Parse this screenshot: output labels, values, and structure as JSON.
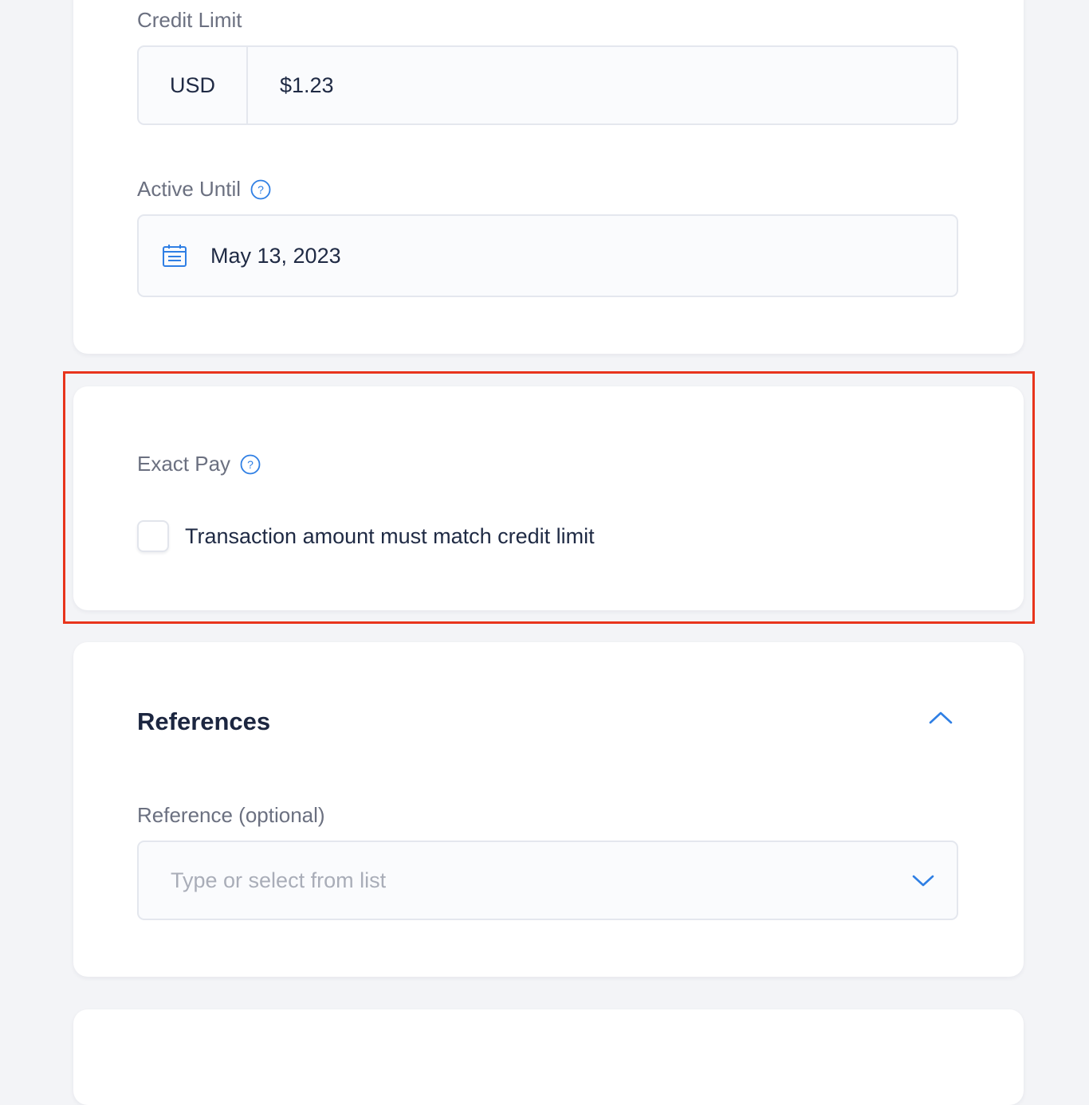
{
  "credit_limit": {
    "label": "Credit Limit",
    "currency": "USD",
    "amount": "$1.23"
  },
  "active_until": {
    "label": "Active Until",
    "help_icon": "help-circle-icon",
    "date": "May 13, 2023",
    "calendar_icon": "calendar-icon"
  },
  "exact_pay": {
    "label": "Exact Pay",
    "help_icon": "help-circle-icon",
    "checkbox_label": "Transaction amount must match credit limit",
    "checked": false
  },
  "references": {
    "title": "References",
    "collapse_icon": "chevron-up-icon",
    "reference_label": "Reference (optional)",
    "reference_placeholder": "Type or select from list",
    "dropdown_icon": "chevron-down-icon"
  },
  "colors": {
    "accent": "#2f7fe4",
    "highlight": "#e8341c",
    "background": "#f3f4f7",
    "text": "#1f2a44",
    "label": "#6b7080"
  }
}
